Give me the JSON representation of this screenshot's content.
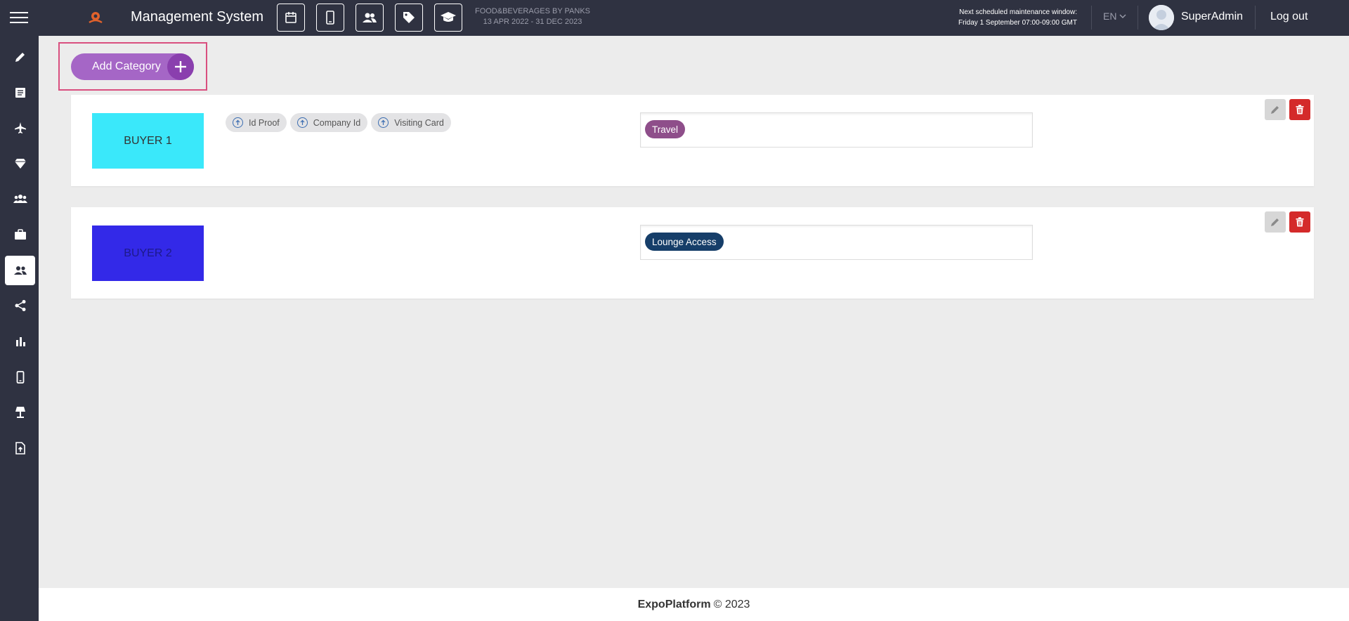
{
  "header": {
    "title": "Management System",
    "event_name": "FOOD&BEVERAGES BY PANKS",
    "event_dates": "13 APR 2022 - 31 DEC 2023",
    "maintenance_line1": "Next scheduled maintenance window:",
    "maintenance_line2": "Friday 1 September 07:00-09:00 GMT",
    "language": "EN",
    "username": "SuperAdmin",
    "logout_label": "Log out",
    "icons": [
      "calendar-icon",
      "mobile-icon",
      "users-icon",
      "tag-icon",
      "graduation-cap-icon"
    ]
  },
  "sidebar": {
    "items": [
      "pencil-icon",
      "list-icon",
      "plane-icon",
      "diamond-icon",
      "group-icon",
      "briefcase-icon",
      "people-icon",
      "share-icon",
      "bar-chart-icon",
      "mobile-icon",
      "lamp-icon",
      "file-upload-icon"
    ],
    "active_index": 6
  },
  "add_button": {
    "label": "Add Category"
  },
  "categories": [
    {
      "name": "BUYER 1",
      "color": "#3ae8fa",
      "text_color": "#333333",
      "documents": [
        "Id Proof",
        "Company Id",
        "Visiting Card"
      ],
      "tag": {
        "label": "Travel",
        "color": "#8e4e8a"
      }
    },
    {
      "name": "BUYER 2",
      "color": "#3329e8",
      "text_color": "#1d1a8a",
      "documents": [],
      "tag": {
        "label": "Lounge Access",
        "color": "#163e69"
      }
    }
  ],
  "footer": {
    "brand": "ExpoPlatform",
    "copyright": "© 2023"
  },
  "colors": {
    "topbar": "#2f3241",
    "accent": "#a566c6",
    "accent_dark": "#8a3fae",
    "delete": "#d42a2a"
  }
}
